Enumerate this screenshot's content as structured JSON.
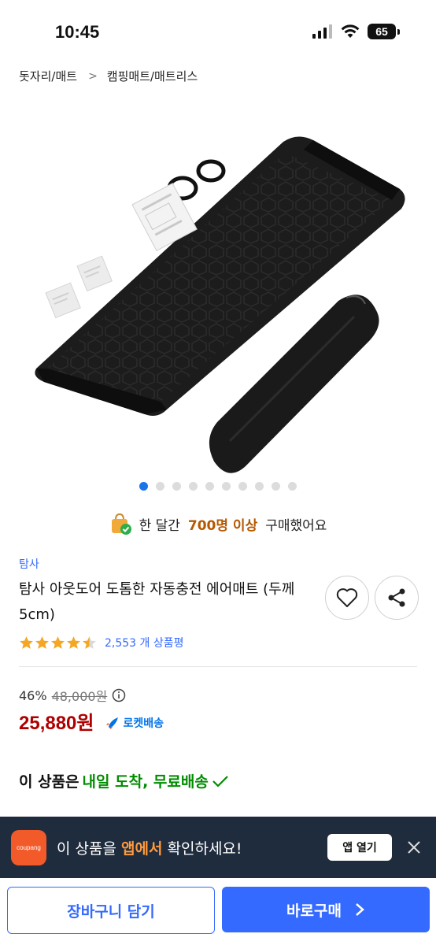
{
  "status_bar": {
    "time": "10:45",
    "battery": "65"
  },
  "breadcrumb": [
    "돗자리/매트",
    "캠핑매트/매트리스"
  ],
  "carousel": {
    "count": 10,
    "active": 0
  },
  "purchase_banner": {
    "prefix": "한 달간",
    "highlight": "700명 이상",
    "suffix": "구매했어요"
  },
  "product": {
    "brand": "탐사",
    "title": "탐사 아웃도어 도톰한 자동충전 에어매트 (두께 5cm)",
    "rating": 4.5,
    "review_count": "2,553 개 상품평",
    "discount": "46%",
    "original_price": "48,000원",
    "price": "25,880원",
    "rocket_label": "로켓배송"
  },
  "delivery": {
    "prefix": "이 상품은",
    "highlight": "내일 도착, 무료배송"
  },
  "app_banner": {
    "logo_text": "coupang",
    "text_before": "이 상품을",
    "text_accent": "앱에서",
    "text_after": "확인하세요!",
    "open_label": "앱 열기"
  },
  "bottom_bar": {
    "cart_label": "장바구니 담기",
    "buy_label": "바로구매"
  },
  "colors": {
    "accent": "#346aff",
    "price": "#ae0000",
    "delivery_green": "#008c00",
    "banner_bg": "#1f2c3d"
  }
}
